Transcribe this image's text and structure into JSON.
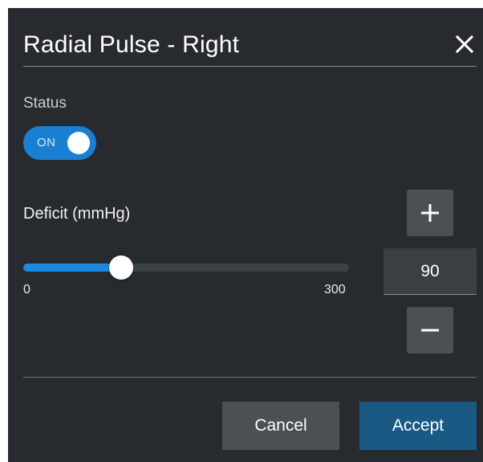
{
  "dialog": {
    "title": "Radial Pulse - Right",
    "close_icon": "close-icon"
  },
  "status": {
    "label": "Status",
    "toggle_text": "ON",
    "toggle_on": true
  },
  "deficit": {
    "label": "Deficit (mmHg)",
    "value": "90",
    "slider_min": "0",
    "slider_max": "300",
    "slider_value": 90,
    "plus_icon": "plus-icon",
    "minus_icon": "minus-icon"
  },
  "footer": {
    "cancel_label": "Cancel",
    "accept_label": "Accept"
  },
  "colors": {
    "background": "#272b2f",
    "accent": "#1a8ae0",
    "accept_button": "#1a5983",
    "neutral_button": "#4a5053"
  }
}
